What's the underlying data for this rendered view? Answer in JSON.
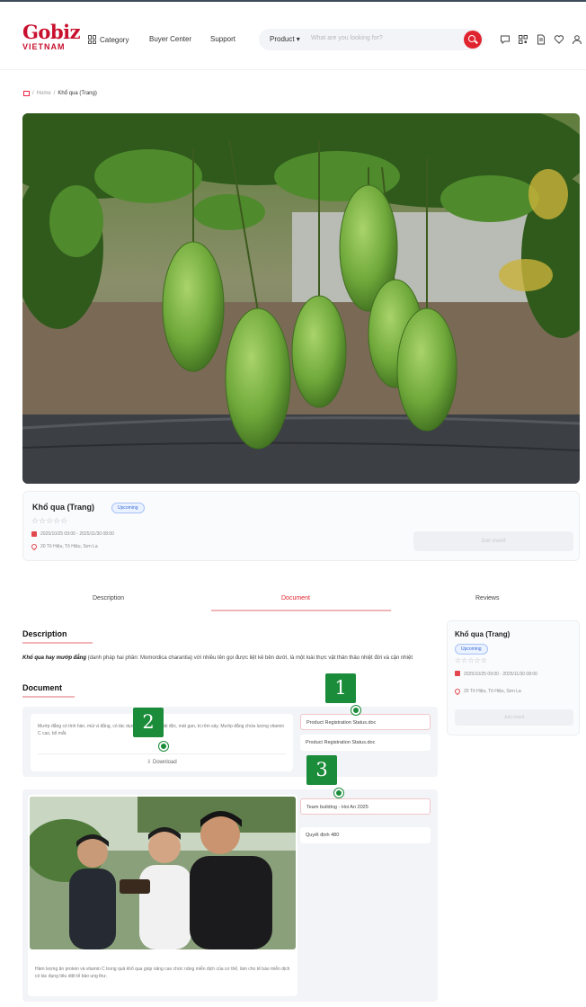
{
  "header": {
    "logo_top": "Gobiz",
    "logo_bottom": "VIETNAM",
    "nav": {
      "category": "Category",
      "buyer_center": "Buyer Center",
      "support": "Support"
    },
    "search": {
      "select_value": "Product",
      "placeholder": "What are you looking for?"
    },
    "icons": [
      "chat-icon",
      "qr-icon",
      "document-icon",
      "heart-icon",
      "user-icon"
    ]
  },
  "breadcrumb": {
    "home": "Home",
    "current": "Khổ qua (Trang)"
  },
  "product": {
    "name": "Khổ qua (Trang)",
    "status": "Upcoming",
    "stars": "☆☆☆☆☆",
    "dates": "2025/10/25 09:00 - 2025/11/30 08:00",
    "location": "20 Tô Hiệu, Tô Hiệu, Sơn La",
    "action_label": "Join event"
  },
  "tabs": {
    "description": "Description",
    "document": "Document",
    "reviews": "Reviews"
  },
  "description": {
    "title": "Description",
    "lead": "Khổ qua hay mướp đắng",
    "body": " (danh pháp hai phần: Momordica charantia) với nhiều tên gọi được liệt kê bên dưới, là một loài thực vật thân thảo nhiệt đới và cận nhiệt"
  },
  "document": {
    "title": "Document",
    "card_text": "Mướp đắng có tính hàn, mùi vị đắng, có tác dụng thanh nhiệt giải độc, mát gan, trị rôm sảy. Mướp đắng chứa lượng vitamin C cao, bổ mắt.",
    "download_label": "Download",
    "list": [
      "Product Registration Status.doc",
      "Product Registration Status.doc"
    ]
  },
  "media": {
    "caption": "Hàm lượng ăn protein và vitamin C trong quả khổ qua giúp nâng cao chức năng miễn dịch của cơ thể, làm cho tế bào miễn dịch có tác dụng tiêu diệt tế bào ung thư.",
    "list": [
      "Team building - Hoi An 2025",
      "Quyết định 480"
    ]
  },
  "sidebar": {
    "name": "Khổ qua (Trang)",
    "status": "Upcoming",
    "stars": "☆☆☆☆☆",
    "dates": "2025/10/25 09:00 - 2025/11/30 08:00",
    "location": "20 Tô Hiệu, Tô Hiệu, Sơn La",
    "action_label": "Join event"
  },
  "markers": [
    "1",
    "2",
    "3"
  ],
  "colors": {
    "brand": "#c8102e",
    "accent": "#e0242f",
    "marker": "#1a8c3a",
    "badge": "#3a6cd9"
  }
}
